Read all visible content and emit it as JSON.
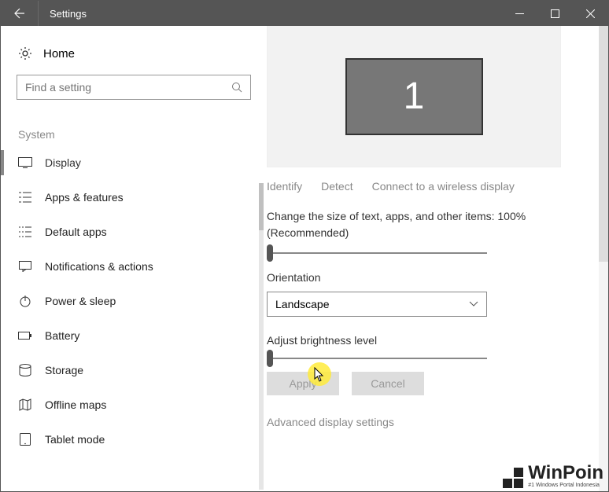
{
  "titlebar": {
    "title": "Settings"
  },
  "left": {
    "home": "Home",
    "search_placeholder": "Find a setting",
    "section": "System",
    "nav": [
      {
        "label": "Display"
      },
      {
        "label": "Apps & features"
      },
      {
        "label": "Default apps"
      },
      {
        "label": "Notifications & actions"
      },
      {
        "label": "Power & sleep"
      },
      {
        "label": "Battery"
      },
      {
        "label": "Storage"
      },
      {
        "label": "Offline maps"
      },
      {
        "label": "Tablet mode"
      }
    ]
  },
  "right": {
    "monitor_number": "1",
    "links": {
      "identify": "Identify",
      "detect": "Detect",
      "wireless": "Connect to a wireless display"
    },
    "scale_label": "Change the size of text, apps, and other items: 100% (Recommended)",
    "orientation_label": "Orientation",
    "orientation_value": "Landscape",
    "brightness_label": "Adjust brightness level",
    "apply": "Apply",
    "cancel": "Cancel",
    "advanced": "Advanced display settings"
  },
  "watermark": {
    "brand": "WinPoin",
    "tagline": "#1 Windows Portal Indonesia"
  }
}
